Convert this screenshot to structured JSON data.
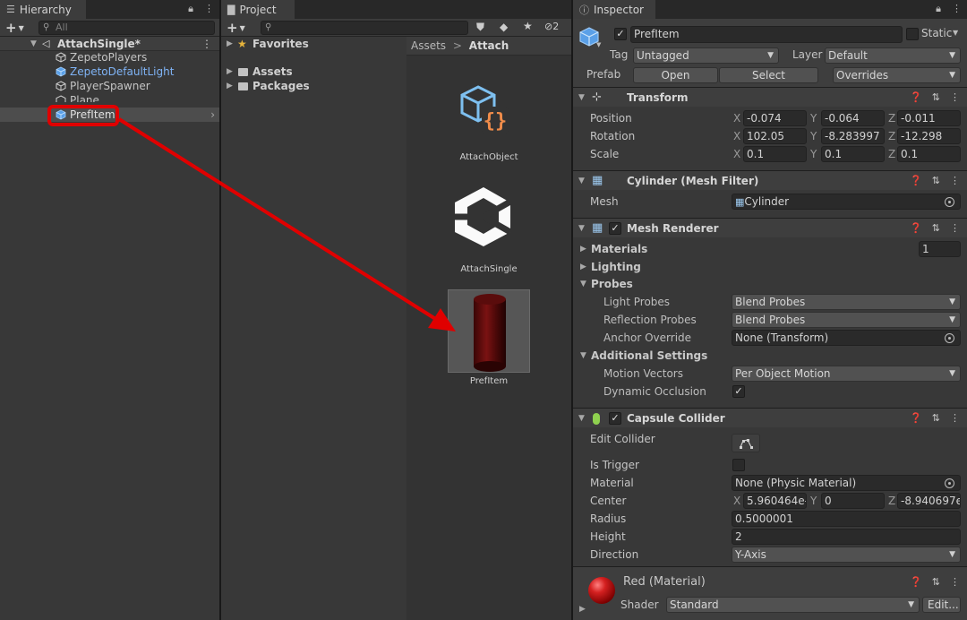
{
  "hierarchy": {
    "tab": "Hierarchy",
    "search_placeholder": "All",
    "scene": "AttachSingle*",
    "items": [
      "ZepetoPlayers",
      "ZepetoDefaultLight",
      "PlayerSpawner",
      "Plane",
      "PrefItem"
    ]
  },
  "project": {
    "tab": "Project",
    "favorites": "Favorites",
    "assets": "Assets",
    "packages": "Packages",
    "breadcrumb_root": "Assets",
    "breadcrumb_current": "Attach",
    "hidden_count": "2",
    "asset_items": [
      "AttachObject",
      "AttachSingle",
      "PrefItem"
    ]
  },
  "inspector": {
    "tab": "Inspector",
    "object_name": "PrefItem",
    "static_label": "Static",
    "tag_label": "Tag",
    "tag_value": "Untagged",
    "layer_label": "Layer",
    "layer_value": "Default",
    "prefab_label": "Prefab",
    "open_label": "Open",
    "select_label": "Select",
    "overrides_label": "Overrides",
    "transform": {
      "title": "Transform",
      "position_label": "Position",
      "rotation_label": "Rotation",
      "scale_label": "Scale",
      "position": [
        "-0.074",
        "-0.064",
        "-0.011"
      ],
      "rotation": [
        "102.05",
        "-8.283997",
        "-12.298"
      ],
      "scale": [
        "0.1",
        "0.1",
        "0.1"
      ]
    },
    "mesh_filter": {
      "title": "Cylinder (Mesh Filter)",
      "mesh_label": "Mesh",
      "mesh_value": "Cylinder"
    },
    "mesh_renderer": {
      "title": "Mesh Renderer",
      "materials": "Materials",
      "materials_count": "1",
      "lighting": "Lighting",
      "probes": "Probes",
      "light_probes_label": "Light Probes",
      "light_probes_value": "Blend Probes",
      "reflection_probes_label": "Reflection Probes",
      "reflection_probes_value": "Blend Probes",
      "anchor_override_label": "Anchor Override",
      "anchor_override_value": "None (Transform)",
      "additional_settings": "Additional Settings",
      "motion_vectors_label": "Motion Vectors",
      "motion_vectors_value": "Per Object Motion",
      "dynamic_occlusion_label": "Dynamic Occlusion"
    },
    "capsule_collider": {
      "title": "Capsule Collider",
      "edit_collider_label": "Edit Collider",
      "is_trigger_label": "Is Trigger",
      "material_label": "Material",
      "material_value": "None (Physic Material)",
      "center_label": "Center",
      "center": [
        "5.960464e-",
        "0",
        "-8.940697e"
      ],
      "radius_label": "Radius",
      "radius_value": "0.5000001",
      "height_label": "Height",
      "height_value": "2",
      "direction_label": "Direction",
      "direction_value": "Y-Axis"
    },
    "material": {
      "title": "Red (Material)",
      "shader_label": "Shader",
      "shader_value": "Standard",
      "edit_label": "Edit..."
    }
  },
  "colors": {
    "accent_blue": "#7fb3f5",
    "highlight_red": "#e00000",
    "panel": "#383838"
  }
}
